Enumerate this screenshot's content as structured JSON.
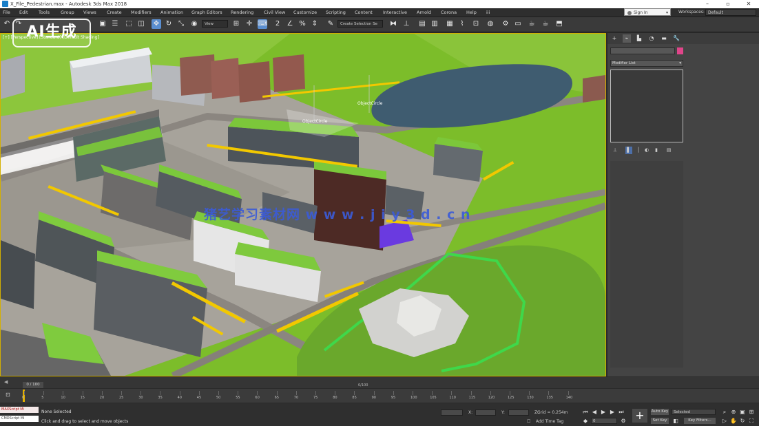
{
  "window": {
    "title": "X_File_Pedestrian.max - Autodesk 3ds Max 2018",
    "minimize": "–",
    "maximize": "▫",
    "close": "✕"
  },
  "menu": {
    "items": [
      "File",
      "Edit",
      "Tools",
      "Group",
      "Views",
      "Create",
      "Modifiers",
      "Animation",
      "Graph Editors",
      "Rendering",
      "Civil View",
      "Customize",
      "Scripting",
      "Content",
      "Interactive",
      "Arnold",
      "Corona",
      "Help",
      "iii"
    ]
  },
  "signin": {
    "label": "Sign In",
    "caret": "▾"
  },
  "workspace": {
    "label": "Workspaces:",
    "value": "Default"
  },
  "toolbar": {
    "view_select": "View",
    "selection_set": "Create Selection Se"
  },
  "watermark": {
    "ai_badge": "AI生成",
    "site_text": "猪艺学习素材网  w w w . j i y 3 d . c n"
  },
  "viewport": {
    "label": "[+] [Perspective] [Standard] [Default Shading]",
    "objects": {
      "object_a": "ObjectCircle",
      "object_b": "ObjectCircle"
    }
  },
  "command_panel": {
    "modifier_list": "Modifier List",
    "caret": "▾"
  },
  "timeline": {
    "frame_field": "0 / 100",
    "top_label": "0/100",
    "ticks": [
      "0",
      "5",
      "10",
      "15",
      "20",
      "25",
      "30",
      "35",
      "40",
      "45",
      "50",
      "55",
      "60",
      "65",
      "70",
      "75",
      "80",
      "85",
      "90",
      "95",
      "100",
      "105",
      "110",
      "115",
      "120",
      "125",
      "130",
      "135",
      "140"
    ]
  },
  "status": {
    "maxscript_label": "MAXScript Mi",
    "maxscript_label2": "CMDScript Mi",
    "none_selected": "None Selected",
    "prompt": "Click and drag to select and move objects",
    "x_label": "X:",
    "y_label": "Y:",
    "z_label": "Z:",
    "grid": "Grid = 0.254m",
    "add_time_tag": "Add Time Tag",
    "auto_key": "Auto Key",
    "set_key": "Set Key",
    "selected": "Selected",
    "key_filters": "Key Filters...",
    "frame_value": "0"
  }
}
